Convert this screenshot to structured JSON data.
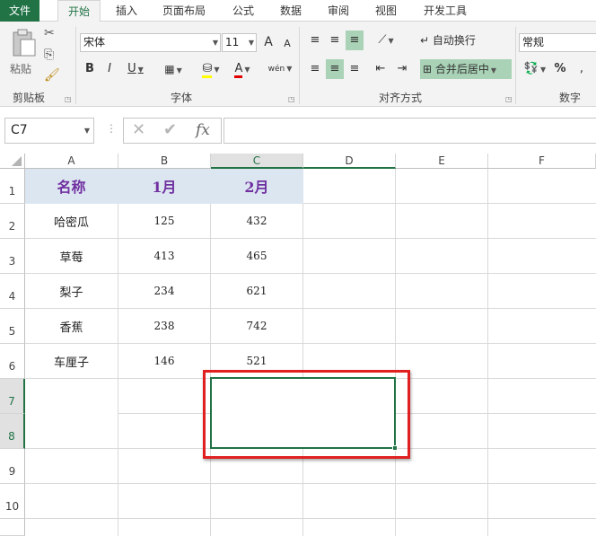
{
  "tabs": [
    "文件",
    "开始",
    "插入",
    "页面布局",
    "公式",
    "数据",
    "审阅",
    "视图",
    "开发工具"
  ],
  "clipboard": {
    "paste_label": "粘贴",
    "group_label": "剪贴板"
  },
  "font": {
    "name": "宋体",
    "size": "11",
    "group_label": "字体",
    "bold": "B",
    "italic": "I",
    "underline": "U",
    "grow": "A",
    "shrink": "A",
    "font_color": "A",
    "wen": "wén"
  },
  "alignment": {
    "wrap_label": "自动换行",
    "merge_label": "合并后居中",
    "group_label": "对齐方式"
  },
  "number": {
    "format": "常规",
    "group_label": "数字",
    "percent": "%"
  },
  "formula_bar": {
    "name_box": "C7",
    "fx": "fx",
    "cancel": "✕",
    "enter": "✔",
    "formula": ""
  },
  "columns": [
    "A",
    "B",
    "C",
    "D",
    "E",
    "F"
  ],
  "rows": [
    "1",
    "2",
    "3",
    "4",
    "5",
    "6",
    "7",
    "8",
    "9",
    "10"
  ],
  "table": {
    "headers": [
      "名称",
      "1月",
      "2月"
    ],
    "rows": [
      [
        "哈密瓜",
        "125",
        "432"
      ],
      [
        "草莓",
        "413",
        "465"
      ],
      [
        "梨子",
        "234",
        "621"
      ],
      [
        "香蕉",
        "238",
        "742"
      ],
      [
        "车厘子",
        "146",
        "521"
      ]
    ]
  },
  "selected_cell": "C7",
  "colors": {
    "accent": "#217346",
    "header_fill": "#dce6f1",
    "header_text": "#7030a0",
    "highlight_border": "#e02020"
  }
}
